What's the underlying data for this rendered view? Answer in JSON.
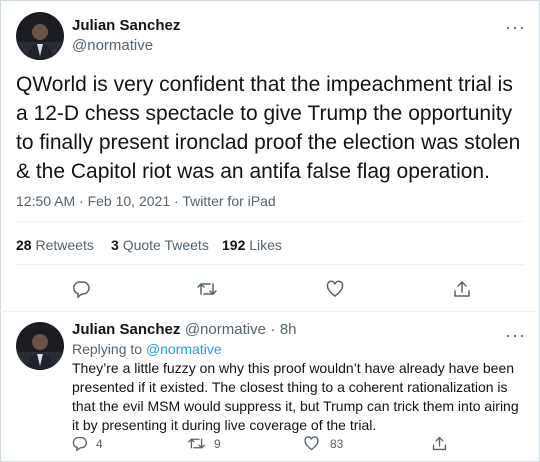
{
  "tweet": {
    "author_name": "Julian Sanchez",
    "author_handle": "@normative",
    "more_label": "···",
    "text": "QWorld is very confident that the impeachment trial is a 12-D chess spectacle to give Trump the opportunity to finally present ironclad proof the election was stolen & the Capitol riot was an antifa false flag operation.",
    "time": "12:50 AM · Feb 10, 2021",
    "client": "Twitter for iPad",
    "stats": {
      "retweets_count": "28",
      "retweets_label": "Retweets",
      "quotes_count": "3",
      "quotes_label": "Quote Tweets",
      "likes_count": "192",
      "likes_label": "Likes"
    },
    "actions": [
      "reply-icon",
      "retweet-icon",
      "like-icon",
      "share-icon"
    ]
  },
  "reply": {
    "author_name": "Julian Sanchez",
    "author_handle": "@normative",
    "separator": "·",
    "time": "8h",
    "more_label": "···",
    "replying_to_label": "Replying to",
    "replying_to_handle": "@normative",
    "text": "They’re a little fuzzy on why this proof wouldn’t have already have been presented if it existed.  The closest thing to a coherent rationalization is that the evil MSM would suppress it, but Trump can trick them into airing it by presenting it during live coverage of the trial.",
    "reply_count": "4",
    "retweet_count": "9",
    "like_count": "83"
  },
  "colors": {
    "text": "#0f1419",
    "secondary": "#536471",
    "accent": "#1d9bf0",
    "divider": "#eff3f4"
  }
}
